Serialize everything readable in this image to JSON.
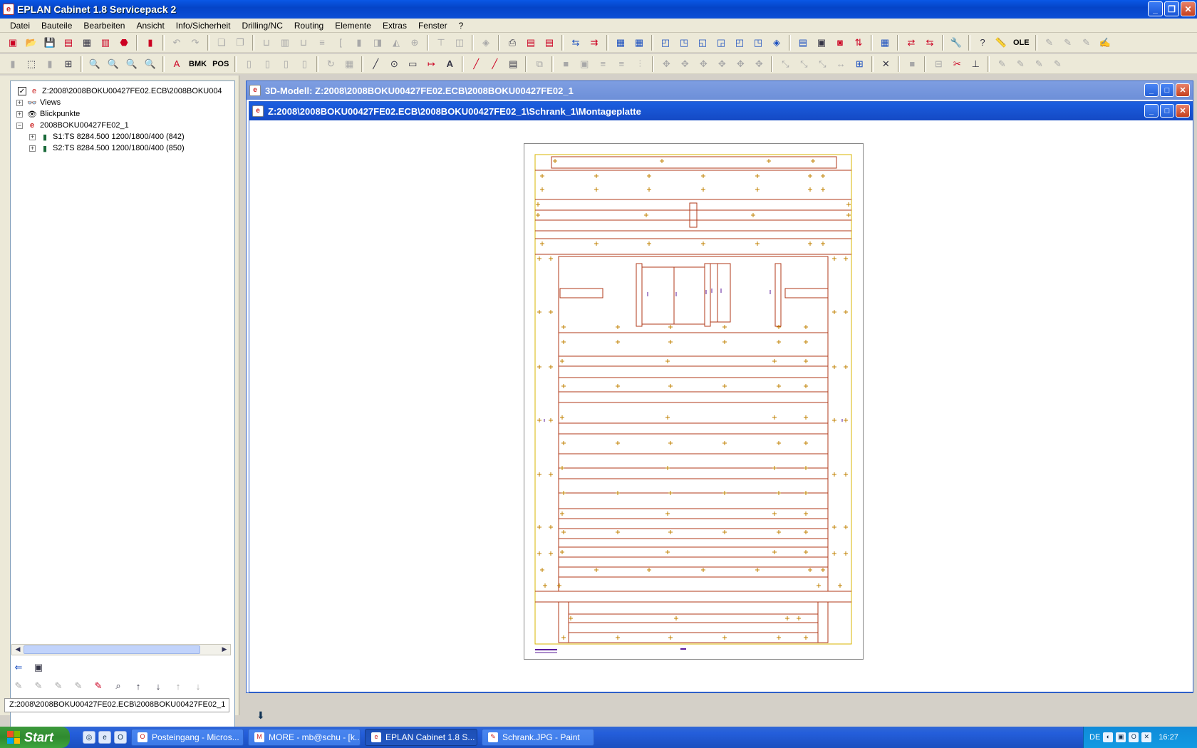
{
  "app": {
    "title": "EPLAN Cabinet 1.8 Servicepack 2"
  },
  "menu": [
    {
      "label": "Datei"
    },
    {
      "label": "Bauteile"
    },
    {
      "label": "Bearbeiten"
    },
    {
      "label": "Ansicht"
    },
    {
      "label": "Info/Sicherheit"
    },
    {
      "label": "Drilling/NC"
    },
    {
      "label": "Routing"
    },
    {
      "label": "Elemente"
    },
    {
      "label": "Extras"
    },
    {
      "label": "Fenster"
    },
    {
      "label": "?"
    }
  ],
  "toolbar": {
    "bmk_label": "BMK",
    "pos_label": "POS",
    "text_label": "A",
    "ole_label": "OLE"
  },
  "tree": {
    "root_label": "Z:2008\\2008BOKU00427FE02.ECB\\2008BOKU004",
    "views_label": "Views",
    "blickpunkte_label": "Blickpunkte",
    "project_label": "2008BOKU00427FE02_1",
    "cabinet1_label": "S1:TS 8284.500  1200/1800/400 (842)",
    "cabinet2_label": "S2:TS 8284.500  1200/1800/400 (850)"
  },
  "status_path": "Z:2008\\2008BOKU00427FE02.ECB\\2008BOKU00427FE02_1",
  "windows": {
    "model3d_title": "3D-Modell: Z:2008\\2008BOKU00427FE02.ECB\\2008BOKU00427FE02_1",
    "montage_title": "Z:2008\\2008BOKU00427FE02.ECB\\2008BOKU00427FE02_1\\Schrank_1\\Montageplatte"
  },
  "drawing_colors": {
    "frame": "#d8b400",
    "rails": "#b03a1a",
    "markers": "#c08000",
    "accent": "#5a1a9a"
  },
  "taskbar": {
    "start_label": "Start",
    "items": [
      {
        "label": "Posteingang - Micros..."
      },
      {
        "label": "MORE - mb@schu - [k..."
      },
      {
        "label": "EPLAN Cabinet 1.8 S..."
      },
      {
        "label": "Schrank.JPG - Paint"
      }
    ],
    "language": "DE",
    "clock": "16:27"
  }
}
